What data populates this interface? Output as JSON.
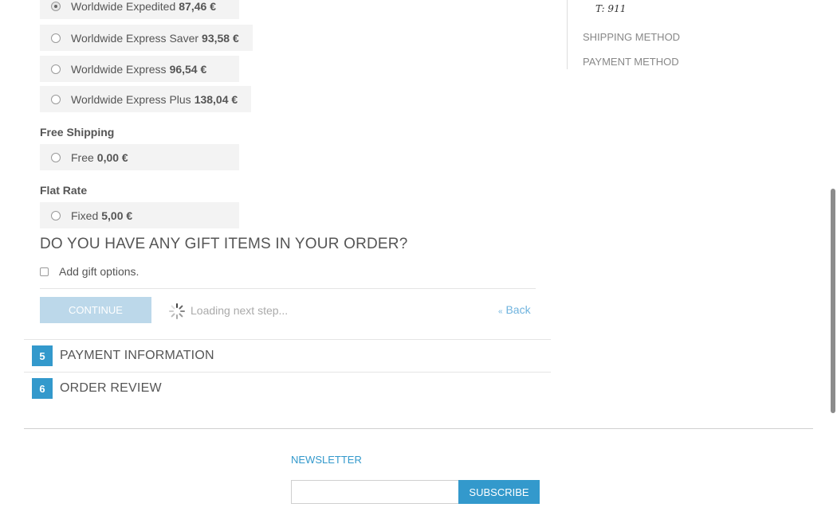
{
  "shipping": {
    "options": [
      {
        "label": "Worldwide Expedited",
        "price": "87,46 €",
        "checked": true
      },
      {
        "label": "Worldwide Express Saver",
        "price": "93,58 €",
        "checked": false
      },
      {
        "label": "Worldwide Express",
        "price": "96,54 €",
        "checked": false
      },
      {
        "label": "Worldwide Express Plus",
        "price": "138,04 €",
        "checked": false
      }
    ],
    "free_title": "Free Shipping",
    "free_option": {
      "label": "Free",
      "price": "0,00 €",
      "checked": false
    },
    "flat_title": "Flat Rate",
    "flat_option": {
      "label": "Fixed",
      "price": "5,00 €",
      "checked": false
    }
  },
  "gift": {
    "heading": "DO YOU HAVE ANY GIFT ITEMS IN YOUR ORDER?",
    "checkbox_label": "Add gift options."
  },
  "actions": {
    "continue_label": "CONTINUE",
    "loading_text": "Loading next step...",
    "back_arrow": "«",
    "back_label": "Back"
  },
  "steps": [
    {
      "number": "5",
      "title": "PAYMENT INFORMATION"
    },
    {
      "number": "6",
      "title": "ORDER REVIEW"
    }
  ],
  "sidebar": {
    "phone": "T: 911",
    "items": [
      "SHIPPING METHOD",
      "PAYMENT METHOD"
    ]
  },
  "newsletter": {
    "label": "NEWSLETTER",
    "input_value": "",
    "subscribe_label": "SUBSCRIBE"
  },
  "colors": {
    "accent": "#3399cc",
    "option_bg": "#f3f3f3",
    "continue_disabled": "#bcd8ea"
  },
  "icons": {
    "spinner": "loading-spinner-icon"
  }
}
